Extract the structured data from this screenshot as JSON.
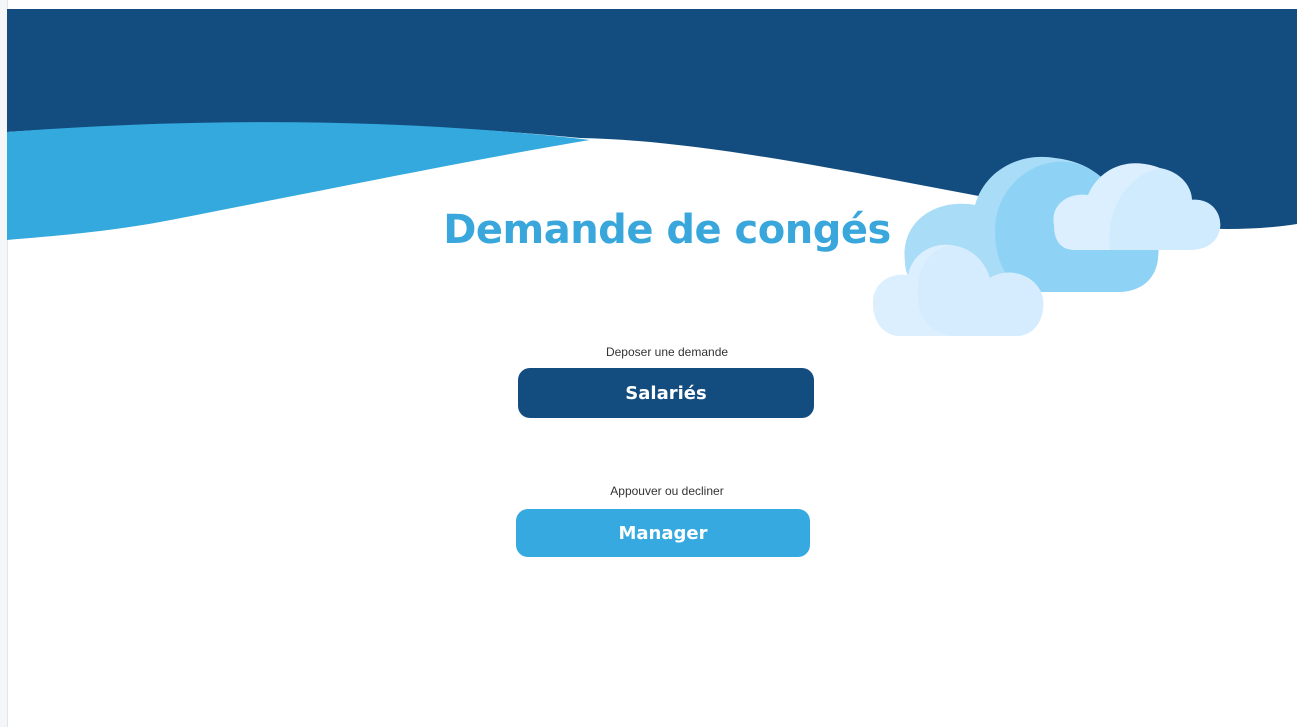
{
  "page": {
    "title": "Demande de congés"
  },
  "employees": {
    "caption": "Deposer une demande",
    "button_label": "Salariés"
  },
  "manager": {
    "caption": "Appouver ou decliner",
    "button_label": "Manager"
  },
  "colors": {
    "dark_blue": "#134d7f",
    "light_blue": "#35a9e0",
    "title_blue": "#3aa7dc",
    "cloud_light": "#dcefff",
    "cloud_mid": "#a9dcf6",
    "cloud_blue": "#8ed3f5"
  }
}
